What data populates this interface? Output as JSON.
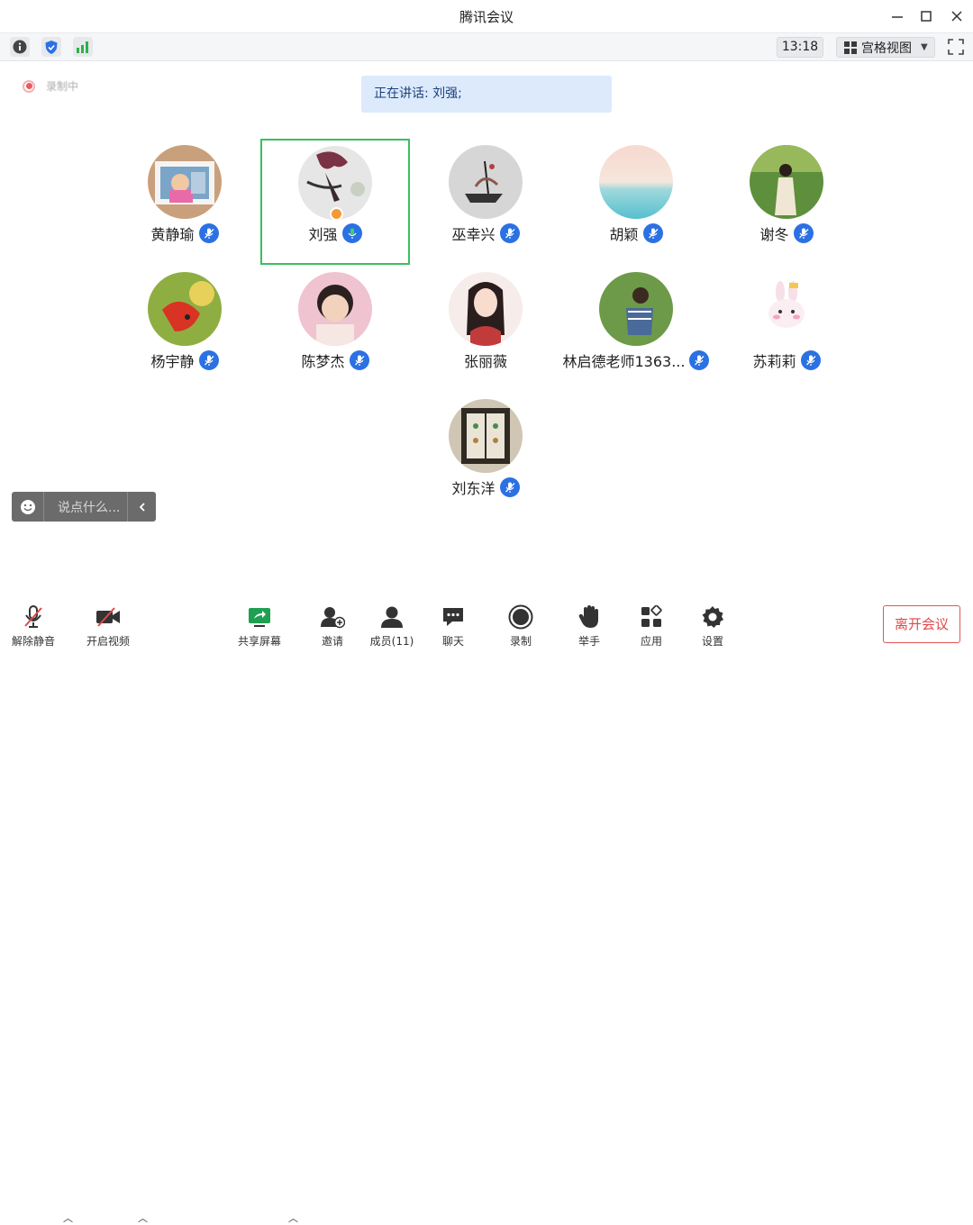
{
  "window": {
    "title": "腾讯会议"
  },
  "toolbar": {
    "time": "13:18",
    "view_label": "宫格视图"
  },
  "recording": {
    "label": "录制中"
  },
  "speaking": {
    "label": "正在讲话: 刘强;"
  },
  "participants": [
    {
      "name": "黄静瑜"
    },
    {
      "name": "刘强"
    },
    {
      "name": "巫幸兴"
    },
    {
      "name": "胡颖"
    },
    {
      "name": "谢冬"
    },
    {
      "name": "杨宇静"
    },
    {
      "name": "陈梦杰"
    },
    {
      "name": "张丽薇"
    },
    {
      "name": "林启德老师1363..."
    },
    {
      "name": "苏莉莉"
    },
    {
      "name": "刘东洋"
    }
  ],
  "chat": {
    "placeholder": "说点什么..."
  },
  "bottom": {
    "unmute": "解除静音",
    "start_video": "开启视频",
    "share_screen": "共享屏幕",
    "invite": "邀请",
    "members": "成员(11)",
    "chat": "聊天",
    "record": "录制",
    "raise_hand": "举手",
    "apps": "应用",
    "settings": "设置",
    "leave": "离开会议"
  },
  "colors": {
    "accent": "#2b71e3",
    "active_border": "#3bbf5f",
    "leave": "#e04848",
    "banner_bg": "#ddeafc"
  }
}
